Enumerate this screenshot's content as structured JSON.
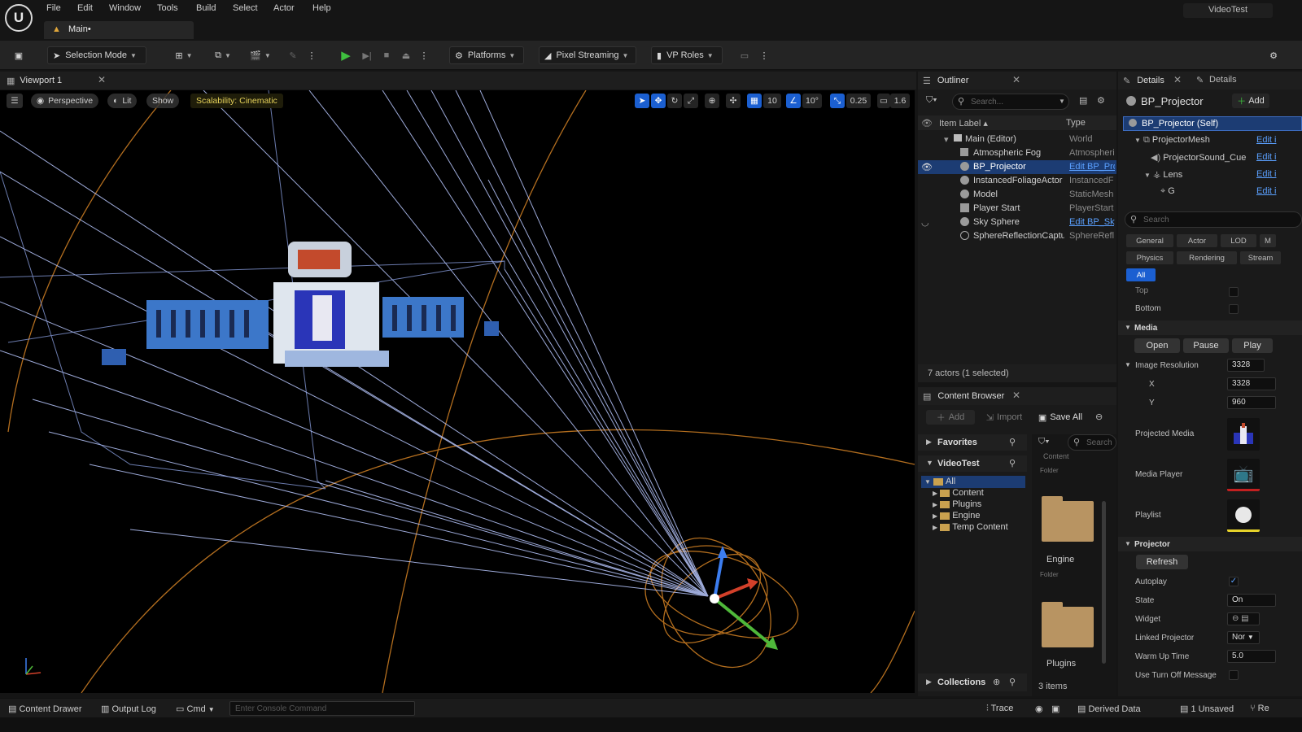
{
  "menu": {
    "items": [
      "File",
      "Edit",
      "Window",
      "Tools",
      "Build",
      "Select",
      "Actor",
      "Help"
    ],
    "project_title": "VideoTest"
  },
  "doc_tab": {
    "label": "Main•"
  },
  "toolbar": {
    "selection_mode": "Selection Mode",
    "platforms": "Platforms",
    "pixel_streaming": "Pixel Streaming",
    "vp_roles": "VP Roles"
  },
  "viewport": {
    "tab": "Viewport 1",
    "perspective": "Perspective",
    "lit": "Lit",
    "show": "Show",
    "scalability": "Scalability: Cinematic",
    "grid_snap": "10",
    "rotation_snap": "10°",
    "scale_snap": "0.25",
    "camera_speed": "1.6"
  },
  "outliner": {
    "tab": "Outliner",
    "search_placeholder": "Search...",
    "col_label": "Item Label ▴",
    "col_type": "Type",
    "rows": [
      {
        "name": "Main (Editor)",
        "type": "World"
      },
      {
        "name": "Atmospheric Fog",
        "type": "Atmospheri"
      },
      {
        "name": "BP_Projector",
        "type": "Edit BP_Pro"
      },
      {
        "name": "InstancedFoliageActor",
        "type": "InstancedF"
      },
      {
        "name": "Model",
        "type": "StaticMesh"
      },
      {
        "name": "Player Start",
        "type": "PlayerStart"
      },
      {
        "name": "Sky Sphere",
        "type": "Edit BP_Sky"
      },
      {
        "name": "SphereReflectionCaptu",
        "type": "SphereRefl"
      }
    ],
    "status": "7 actors (1 selected)"
  },
  "content_browser": {
    "tab": "Content Browser",
    "add": "Add",
    "import": "Import",
    "save_all": "Save All",
    "favorites": "Favorites",
    "project": "VideoTest",
    "search_placeholder": "Search",
    "tree": [
      "All",
      "Content",
      "Plugins",
      "Engine",
      "Temp Content"
    ],
    "content_label": "Content",
    "folder_type": "Folder",
    "assets": [
      {
        "name": "Engine",
        "type": "Folder"
      },
      {
        "name": "Plugins",
        "type": ""
      }
    ],
    "collections": "Collections",
    "count": "3 items"
  },
  "details": {
    "tab1": "Details",
    "tab2": "Details",
    "actor": "BP_Projector",
    "add": "Add",
    "components": [
      {
        "name": "BP_Projector (Self)",
        "edit": ""
      },
      {
        "name": "ProjectorMesh",
        "edit": "Edit i"
      },
      {
        "name": "ProjectorSound_Cue",
        "edit": "Edit i"
      },
      {
        "name": "Lens",
        "edit": "Edit i"
      },
      {
        "name": "G",
        "edit": "Edit i"
      }
    ],
    "search_placeholder": "Search",
    "filters": [
      "General",
      "Actor",
      "LOD",
      "M",
      "Physics",
      "Rendering",
      "Stream",
      "All"
    ],
    "top": "Top",
    "bottom": "Bottom",
    "media_section": "Media",
    "open": "Open",
    "pause": "Pause",
    "play": "Play",
    "image_resolution": "Image Resolution",
    "res_value": "3328",
    "x_label": "X",
    "x_value": "3328",
    "y_label": "Y",
    "y_value": "960",
    "projected_media": "Projected Media",
    "media_player": "Media Player",
    "playlist": "Playlist",
    "projector_section": "Projector",
    "refresh": "Refresh",
    "autoplay": "Autoplay",
    "state": "State",
    "state_value": "On",
    "widget": "Widget",
    "linked_projector": "Linked Projector",
    "linked_value": "Nor",
    "warm_up": "Warm Up Time",
    "warm_value": "5.0",
    "turn_off": "Use Turn Off Message"
  },
  "statusbar": {
    "content_drawer": "Content Drawer",
    "output_log": "Output Log",
    "cmd": "Cmd",
    "console_placeholder": "Enter Console Command",
    "trace": "Trace",
    "derived_data": "Derived Data",
    "unsaved": "1 Unsaved",
    "rev": "Re"
  },
  "colors": {
    "accent": "#1b5fd1",
    "selection": "#1c3c73",
    "warning": "#e0a63b",
    "link": "#5aa0ff"
  }
}
